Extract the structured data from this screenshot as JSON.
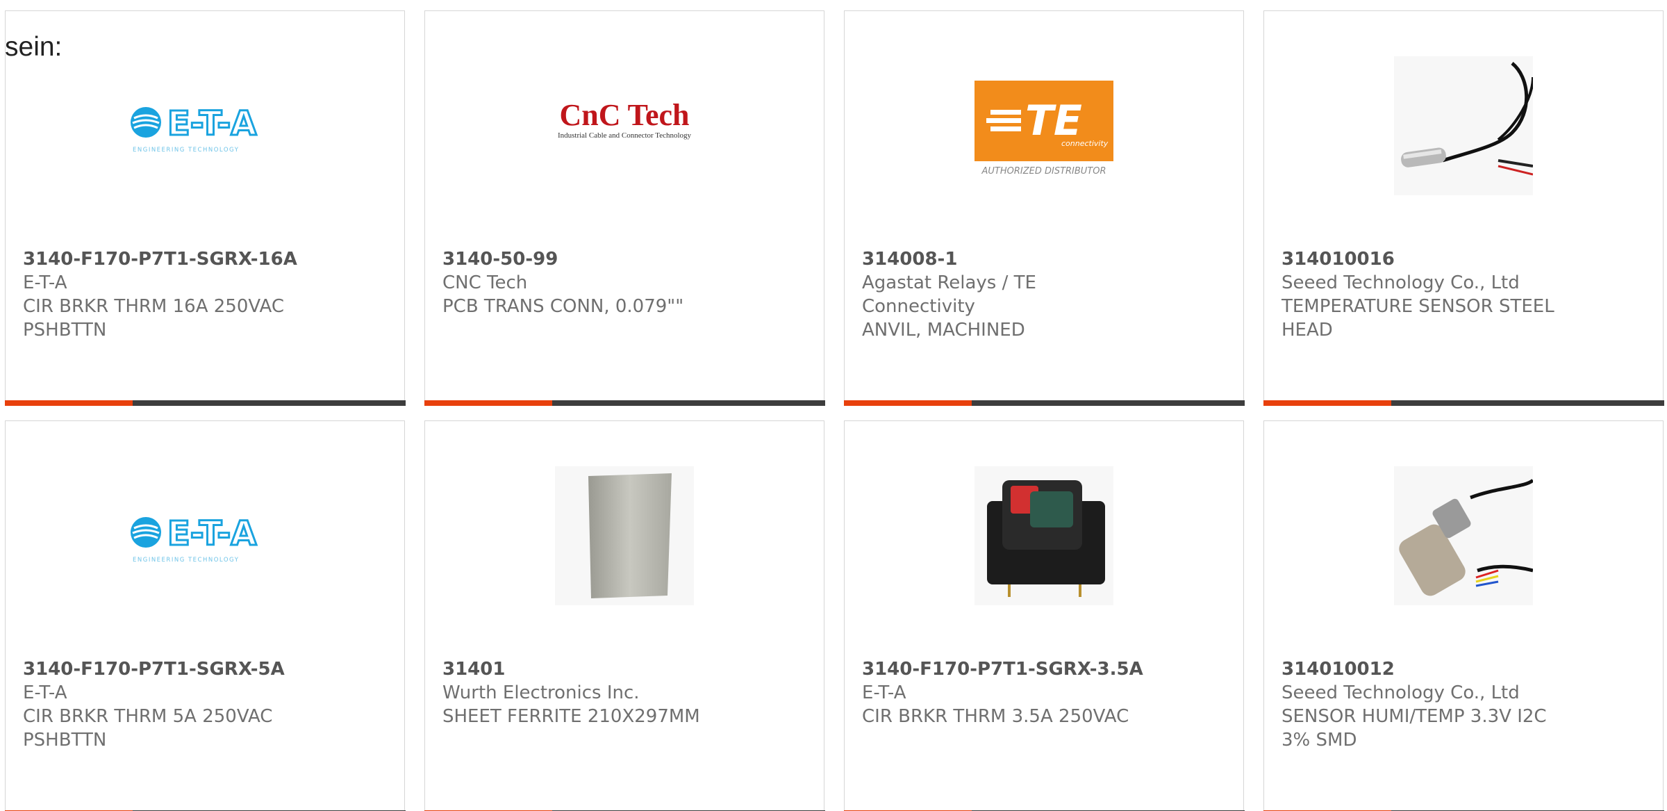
{
  "intro_text": "sein:",
  "colors": {
    "accent_orange": "#e8400c",
    "accent_dark": "#3d3d3d",
    "eta_blue": "#1aa3df",
    "cnc_red": "#c0161b",
    "te_orange": "#f28c1b"
  },
  "products": [
    {
      "part": "3140-F170-P7T1-SGRX-16A",
      "maker": "E-T-A",
      "desc1": "CIR BRKR THRM 16A 250VAC",
      "desc2": "PSHBTTN",
      "image": "eta-logo",
      "logo_text": "E-T-A",
      "logo_sub": "ENGINEERING TECHNOLOGY"
    },
    {
      "part": "3140-50-99",
      "maker": "CNC Tech",
      "desc1": "PCB TRANS CONN, 0.079\"\"",
      "desc2": "",
      "image": "cnc-tech-logo",
      "logo_text": "CnC Tech",
      "logo_sub": "Industrial Cable and Connector Technology"
    },
    {
      "part": "314008-1",
      "maker": "Agastat Relays / TE Connectivity",
      "desc1": "ANVIL, MACHINED",
      "desc2": "",
      "image": "te-connectivity-logo",
      "logo_text": "TE",
      "logo_small": "connectivity",
      "logo_sub": "AUTHORIZED DISTRIBUTOR"
    },
    {
      "part": "314010016",
      "maker": "Seeed Technology Co., Ltd",
      "desc1": "TEMPERATURE SENSOR STEEL",
      "desc2": "HEAD",
      "image": "temperature-probe-photo"
    },
    {
      "part": "3140-F170-P7T1-SGRX-5A",
      "maker": "E-T-A",
      "desc1": "CIR BRKR THRM 5A 250VAC",
      "desc2": "PSHBTTN",
      "image": "eta-logo",
      "logo_text": "E-T-A",
      "logo_sub": "ENGINEERING TECHNOLOGY"
    },
    {
      "part": "31401",
      "maker": "Wurth Electronics Inc.",
      "desc1": "SHEET FERRITE 210X297MM",
      "desc2": "",
      "image": "ferrite-sheet-photo"
    },
    {
      "part": "3140-F170-P7T1-SGRX-3.5A",
      "maker": "E-T-A",
      "desc1": "CIR BRKR THRM 3.5A 250VAC",
      "desc2": "",
      "image": "circuit-breaker-photo"
    },
    {
      "part": "314010012",
      "maker": "Seeed Technology Co., Ltd",
      "desc1": "SENSOR HUMI/TEMP 3.3V I2C",
      "desc2": "3% SMD",
      "image": "humidity-sensor-photo"
    }
  ]
}
